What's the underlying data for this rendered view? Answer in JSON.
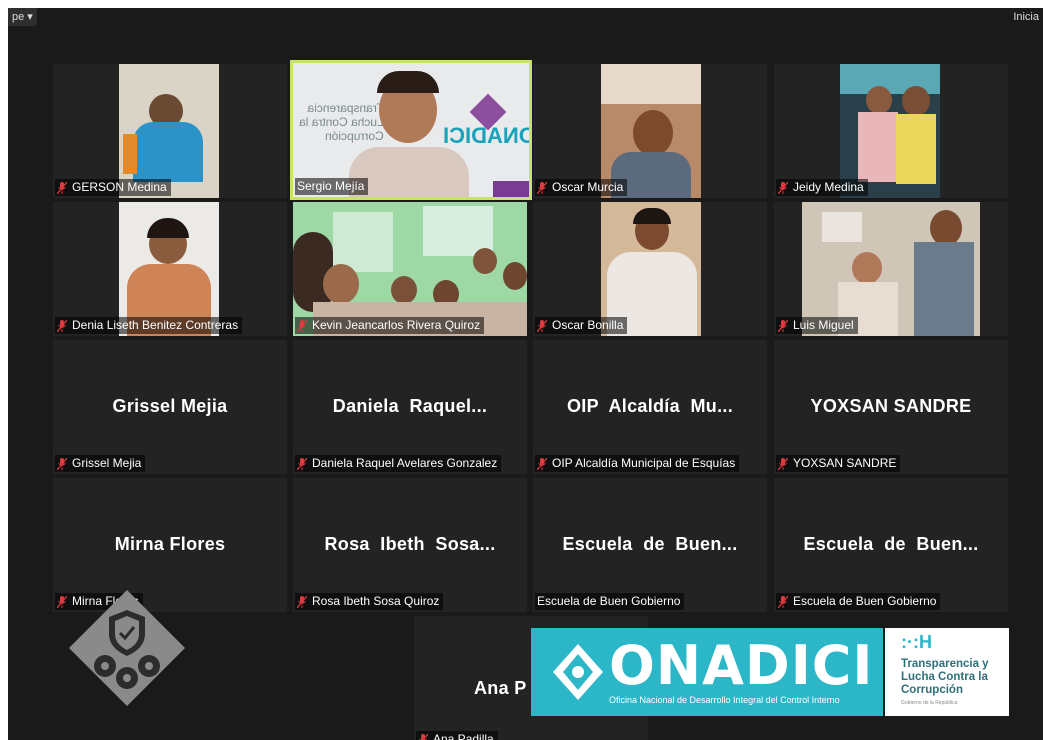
{
  "toolbar": {
    "view_label": "pe ▾",
    "start_label": "Inicia"
  },
  "participants": [
    {
      "label": "GERSON Medina",
      "muted": true
    },
    {
      "label": "Sergio Mejía",
      "muted": false,
      "active_speaker": true
    },
    {
      "label": "Oscar Murcia",
      "muted": true
    },
    {
      "label": "Jeidy Medina",
      "muted": true
    },
    {
      "label": "Denia Liseth Benitez Contreras",
      "muted": true
    },
    {
      "label": "Kevin Jeancarlos Rivera Quiroz",
      "muted": true
    },
    {
      "label": "Oscar Bonilla",
      "muted": true
    },
    {
      "label": "Luis Miguel",
      "muted": true
    },
    {
      "big_name": "Grissel Mejia",
      "label": "Grissel Mejia",
      "muted": true
    },
    {
      "big_name": "Daniela  Raquel...",
      "label": "Daniela Raquel Avelares Gonzalez",
      "muted": true
    },
    {
      "big_name": "OIP  Alcaldía  Mu...",
      "label": "OIP Alcaldía Municipal de Esquías",
      "muted": true
    },
    {
      "big_name": "YOXSAN SANDRE",
      "label": "YOXSAN SANDRE",
      "muted": true
    },
    {
      "big_name": "Mirna Flores",
      "label": "Mirna Flores",
      "muted": true
    },
    {
      "big_name": "Rosa  Ibeth  Sosa...",
      "label": "Rosa Ibeth Sosa Quiroz",
      "muted": true
    },
    {
      "big_name": "Escuela  de  Buen...",
      "label": "Escuela de Buen Gobierno",
      "muted": false
    },
    {
      "big_name": "Escuela  de  Buen...",
      "label": "Escuela de Buen Gobierno",
      "muted": true
    },
    {
      "big_name": "Ana P",
      "label": "Ana Padilla",
      "muted": true
    }
  ],
  "background_sign": {
    "line1": "Transparencia",
    "line2": "Lucha Contra la",
    "line3": "Corrupción",
    "logo": "ONADICI"
  },
  "overlay": {
    "onadici_title": "ONADICI",
    "onadici_subtitle": "Oficina Nacional de Desarrollo Integral del Control Interno",
    "tlc_mark": ":·:H",
    "tlc_text": "Transparencia y Lucha Contra la Corrupción",
    "tlc_small": "Gobierno de la República"
  },
  "colors": {
    "mic_muted": "#e0393e",
    "active_border": "#c7e36a",
    "onadici_teal": "#2cb7c8"
  }
}
